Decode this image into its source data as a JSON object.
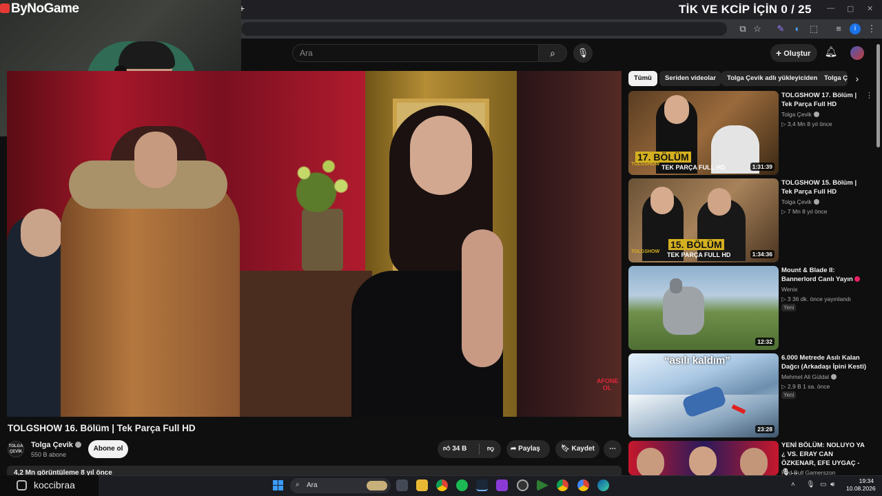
{
  "overlay": {
    "brand": "ByNoGame",
    "goal_text": "TİK VE KCİP İÇİN 0 / 25",
    "instagram_handle": "koccibraa"
  },
  "browser": {
    "new_tab_symbol": "+",
    "window_controls": [
      "—",
      "▢",
      "✕"
    ]
  },
  "masthead": {
    "search_placeholder": "Ara",
    "create_label": "Oluştur"
  },
  "video": {
    "title": "TOLGSHOW 16. Bölüm | Tek Parça Full HD",
    "channel_name": "Tolga Çevik",
    "channel_avatar_text": "TOLGA ÇEVİK",
    "subscribers": "550 B abone",
    "subscribe_label": "Abone ol",
    "likes": "34 B",
    "share_label": "Paylaş",
    "save_label": "Kaydet",
    "description_preview": "4,2 Mn görüntüleme  8 yıl önce",
    "watermark": "AFONE OL"
  },
  "chips": [
    "Tümü",
    "Seriden videolar",
    "Tolga Çevik adlı yükleyiciden",
    "Tolga Ç"
  ],
  "recommendations": [
    {
      "title": "TOLGSHOW 17. Bölüm | Tek Parça Full HD",
      "channel": "Tolga Çevik",
      "meta": "▷ 3,4 Mn  8 yıl önce",
      "duration": "1:31:39",
      "thumb_caption": "17. BÖLÜM",
      "thumb_sub": "TEK PARÇA FULL HD",
      "thumb_tag": "TOLGSHOW"
    },
    {
      "title": "TOLGSHOW 15. Bölüm | Tek Parça Full HD",
      "channel": "Tolga Çevik",
      "meta": "▷ 7 Mn  8 yıl önce",
      "duration": "1:34:36",
      "thumb_caption": "15. BÖLÜM",
      "thumb_sub": "TEK PARÇA FULL HD",
      "thumb_tag": "TOLGSHOW"
    },
    {
      "title": "Mount & Blade II: Bannerlord Canlı Yayın",
      "channel": "Wenix",
      "meta": "▷ 3  36 dk. önce yayınlandı",
      "badge": "Yeni",
      "duration": "12:32"
    },
    {
      "title": "6.000 Metrede Asılı Kalan Dağcı (Arkadaşı İpini Kesti)",
      "channel": "Mehmet Ali Güldal",
      "meta": "▷ 2,9 B  1 sa. önce",
      "badge": "Yeni",
      "duration": "23:28",
      "thumb_caption": "“asılı kaldım”"
    },
    {
      "title": "YENİ BÖLÜM: NOLUYO YA ¿ VS. ERAY CAN ÖZKENAR, EFE UYGAÇ - 🎙 ...",
      "channel": "Red Bull Gamerszon"
    }
  ],
  "taskbar": {
    "search_placeholder": "Ara",
    "time": "19:34",
    "date": "10.08.2026"
  }
}
